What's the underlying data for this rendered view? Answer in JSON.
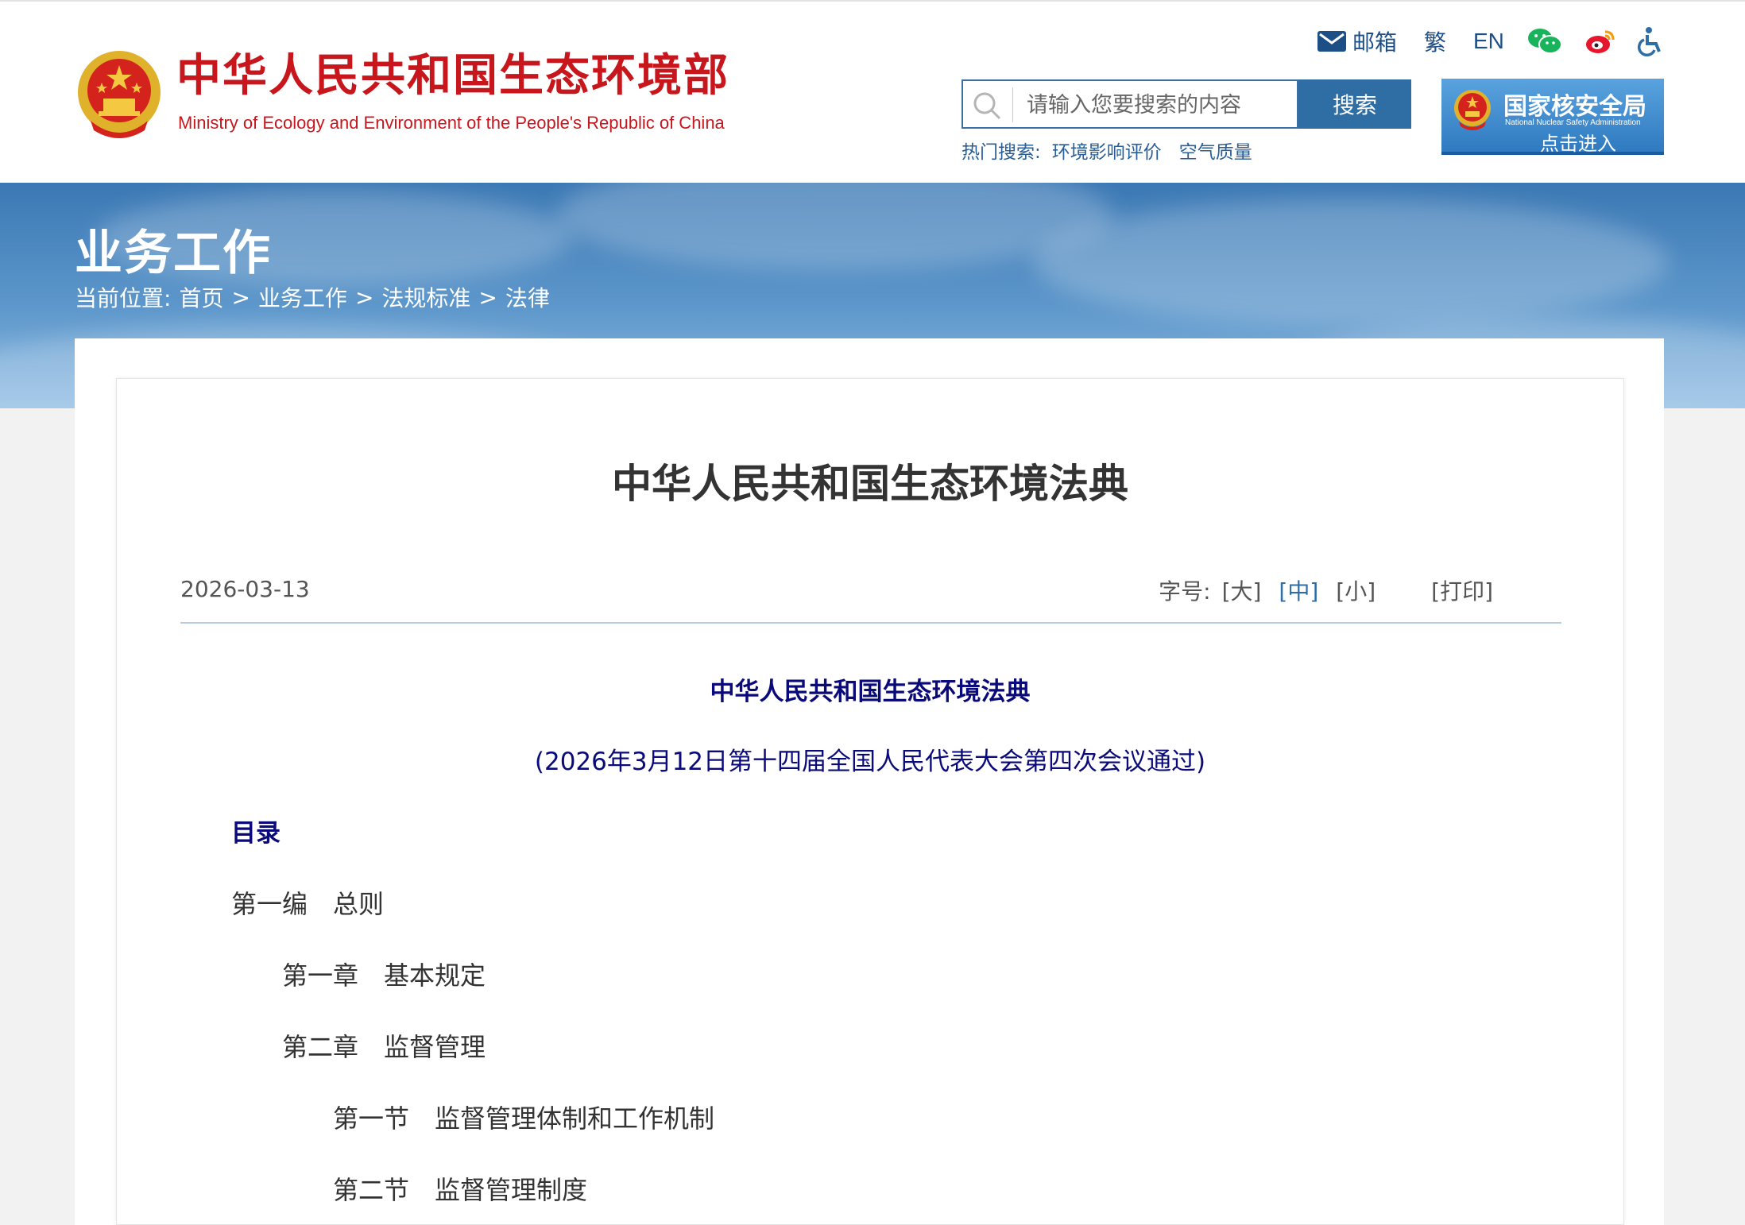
{
  "header": {
    "site_name": "中华人民共和国生态环境部",
    "site_name_en": "Ministry of Ecology and Environment of the People's Republic of China",
    "top_links": {
      "mailbox": "邮箱",
      "traditional": "繁",
      "english": "EN"
    },
    "icons": [
      "mail-icon",
      "wechat-icon",
      "weibo-icon",
      "accessibility-icon",
      "search-icon",
      "national-emblem-icon"
    ],
    "search": {
      "placeholder": "请输入您要搜索的内容",
      "button": "搜索",
      "hot_label": "热门搜索:",
      "hot_items": [
        "环境影响评价",
        "空气质量"
      ]
    },
    "nnsa_banner": {
      "title": "国家核安全局",
      "subtitle": "National Nuclear Safety Administration",
      "enter": "点击进入"
    },
    "colors": {
      "brand_red": "#c8161d",
      "link_blue": "#1d4f86",
      "button_blue": "#2f6ea5"
    }
  },
  "banner": {
    "section_title": "业务工作",
    "breadcrumb": {
      "label": "当前位置:",
      "items": [
        "首页",
        "业务工作",
        "法规标准",
        "法律"
      ],
      "separator": ">"
    }
  },
  "article": {
    "title": "中华人民共和国生态环境法典",
    "date": "2026-03-13",
    "font_tools": {
      "label": "字号:",
      "large": "[大]",
      "medium": "[中]",
      "small": "[小]",
      "print": "[打印]"
    },
    "law_heading": "中华人民共和国生态环境法典",
    "adoption_note": "(2026年3月12日第十四届全国人民代表大会第四次会议通过)",
    "toc_heading": "目录",
    "toc": [
      {
        "num": "第一编",
        "title": "总则"
      },
      {
        "num": "第一章",
        "title": "基本规定"
      },
      {
        "num": "第二章",
        "title": "监督管理"
      },
      {
        "num": "第一节",
        "title": "监督管理体制和工作机制"
      },
      {
        "num": "第二节",
        "title": "监督管理制度"
      }
    ]
  }
}
